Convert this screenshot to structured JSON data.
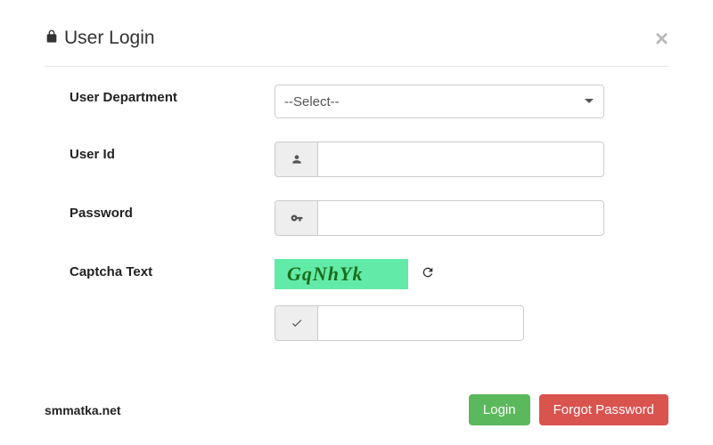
{
  "modal": {
    "title": "User Login"
  },
  "form": {
    "department": {
      "label": "User Department",
      "selected": "--Select--"
    },
    "userId": {
      "label": "User Id",
      "value": ""
    },
    "password": {
      "label": "Password",
      "value": ""
    },
    "captcha": {
      "label": "Captcha Text",
      "code": "GqNhYk",
      "input": ""
    }
  },
  "footer": {
    "site": "smmatka.net",
    "loginButton": "Login",
    "forgotButton": "Forgot Password"
  }
}
